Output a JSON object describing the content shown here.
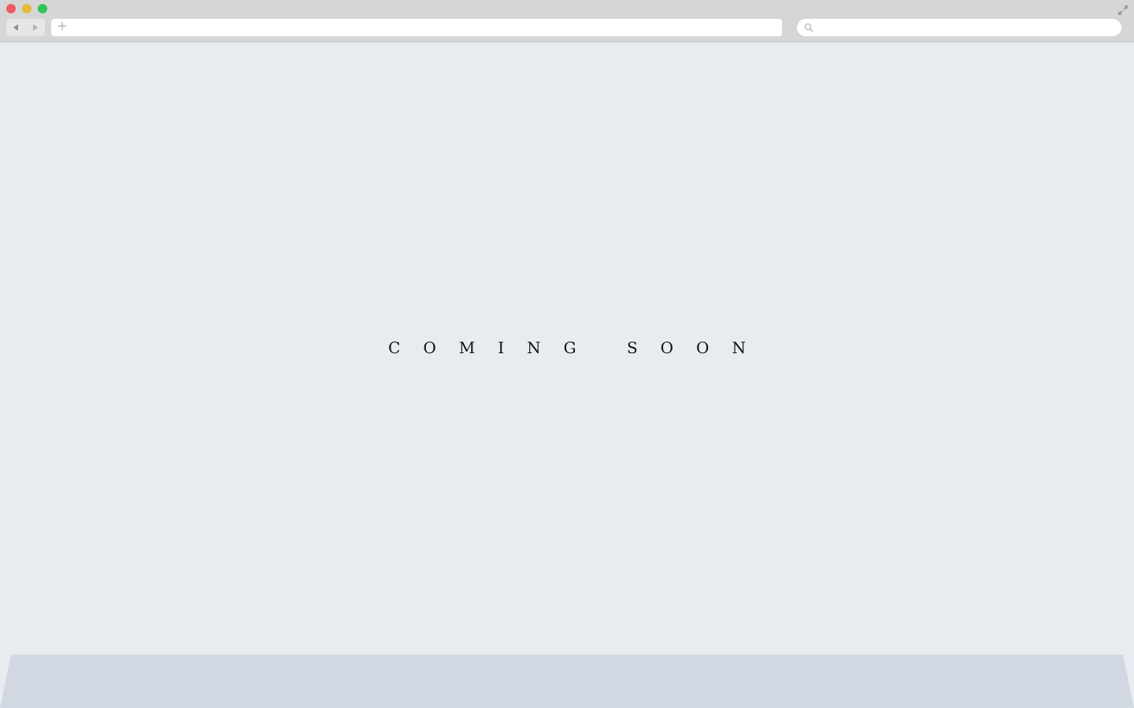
{
  "browser": {
    "address_bar": {
      "value": "",
      "placeholder": ""
    },
    "search_bar": {
      "value": "",
      "placeholder": ""
    },
    "icons": {
      "back": "chevron-left-icon",
      "forward": "chevron-right-icon",
      "new_tab": "plus-icon",
      "search": "search-icon",
      "fullscreen": "fullscreen-icon"
    },
    "colors": {
      "chrome": "#d6d6d6",
      "close": "#ef5b5b",
      "minimize": "#e5b93b",
      "maximize": "#2ec458"
    }
  },
  "page": {
    "headline": "COMING SOON",
    "colors": {
      "background": "#e8ecf1",
      "shelf": "#d2d8e1",
      "text": "#111111"
    }
  }
}
